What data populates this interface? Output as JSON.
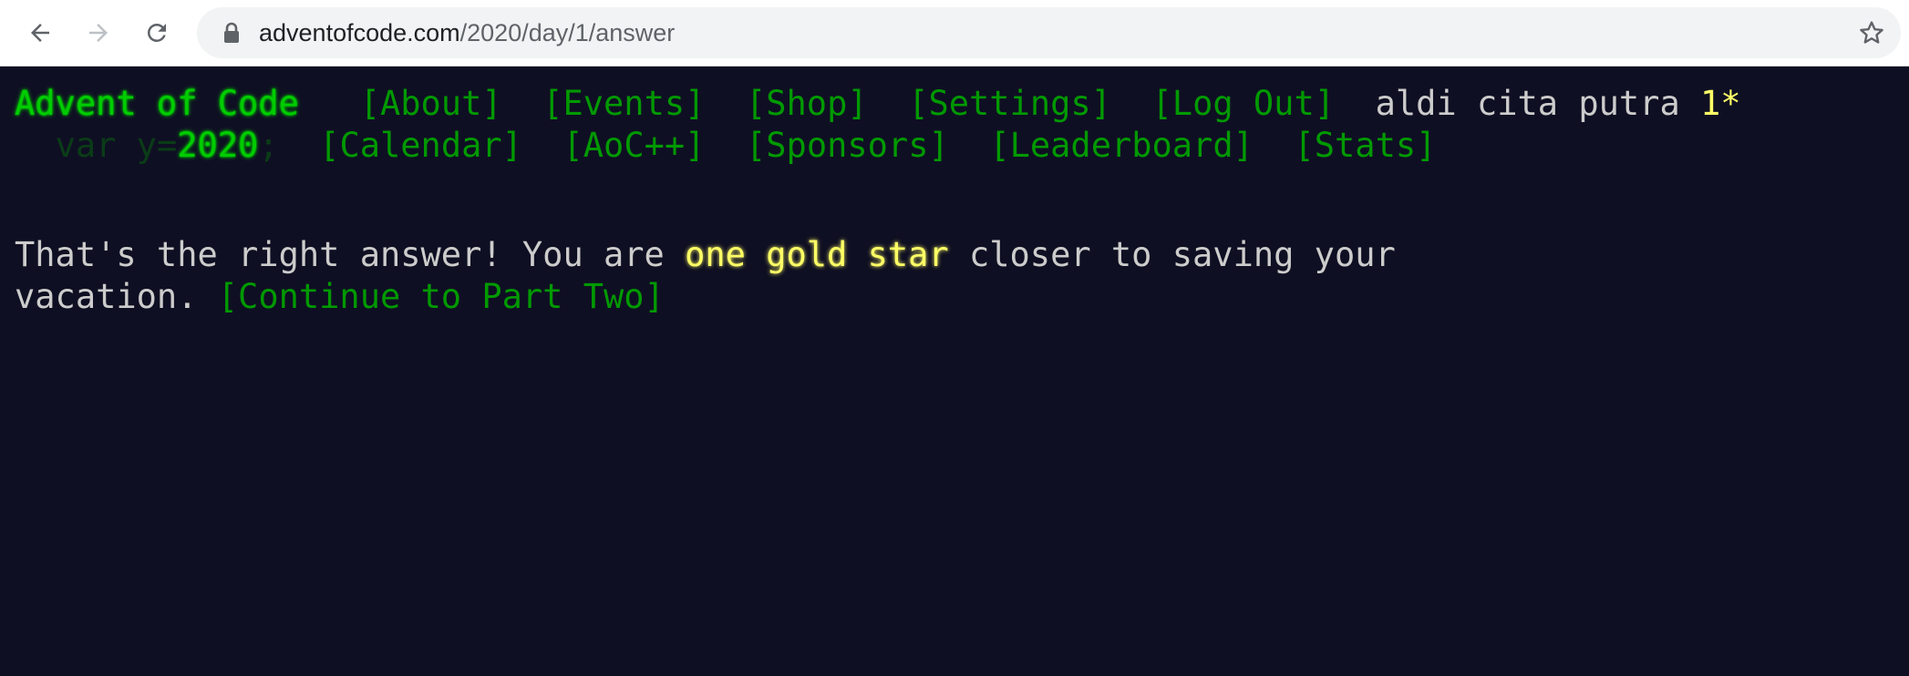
{
  "browser": {
    "url_host": "adventofcode.com",
    "url_path": "/2020/day/1/answer",
    "icons": {
      "back": "arrow-left-icon",
      "forward": "arrow-right-icon",
      "reload": "reload-icon",
      "lock": "lock-icon",
      "bookmark": "star-outline-icon"
    }
  },
  "header": {
    "site_title": "Advent of Code",
    "nav_row1": [
      "[About]",
      "[Events]",
      "[Shop]",
      "[Settings]",
      "[Log Out]"
    ],
    "username": "aldi cita putra",
    "star_count": "1*",
    "year_prefix": "var y=",
    "year": "2020",
    "year_suffix": ";",
    "nav_row2": [
      "[Calendar]",
      "[AoC++]",
      "[Sponsors]",
      "[Leaderboard]",
      "[Stats]"
    ]
  },
  "main": {
    "msg_part1": "That's the right answer! You are ",
    "msg_highlight": "one gold star",
    "msg_part2": " closer to saving your",
    "msg_part3": "vacation. ",
    "continue_link": "[Continue to Part Two]"
  },
  "colors": {
    "background": "#0f0f23",
    "text": "#cccccc",
    "link": "#009900",
    "title": "#00cc00",
    "gold": "#ffff66"
  }
}
